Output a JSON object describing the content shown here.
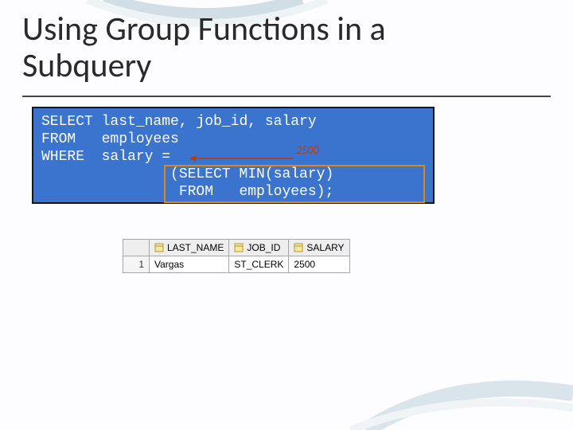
{
  "title_line1": "Using Group Functions in a",
  "title_line2": "Subquery",
  "code": {
    "l1": "SELECT last_name, job_id, salary",
    "l2": "FROM   employees",
    "l3": "WHERE  salary =",
    "l4": "               (SELECT MIN(salary)",
    "l5": "                FROM   employees);"
  },
  "annotation_value": "2500",
  "chart_data": {
    "type": "table",
    "columns": [
      "LAST_NAME",
      "JOB_ID",
      "SALARY"
    ],
    "rows": [
      {
        "n": 1,
        "LAST_NAME": "Vargas",
        "JOB_ID": "ST_CLERK",
        "SALARY": 2500
      }
    ]
  }
}
